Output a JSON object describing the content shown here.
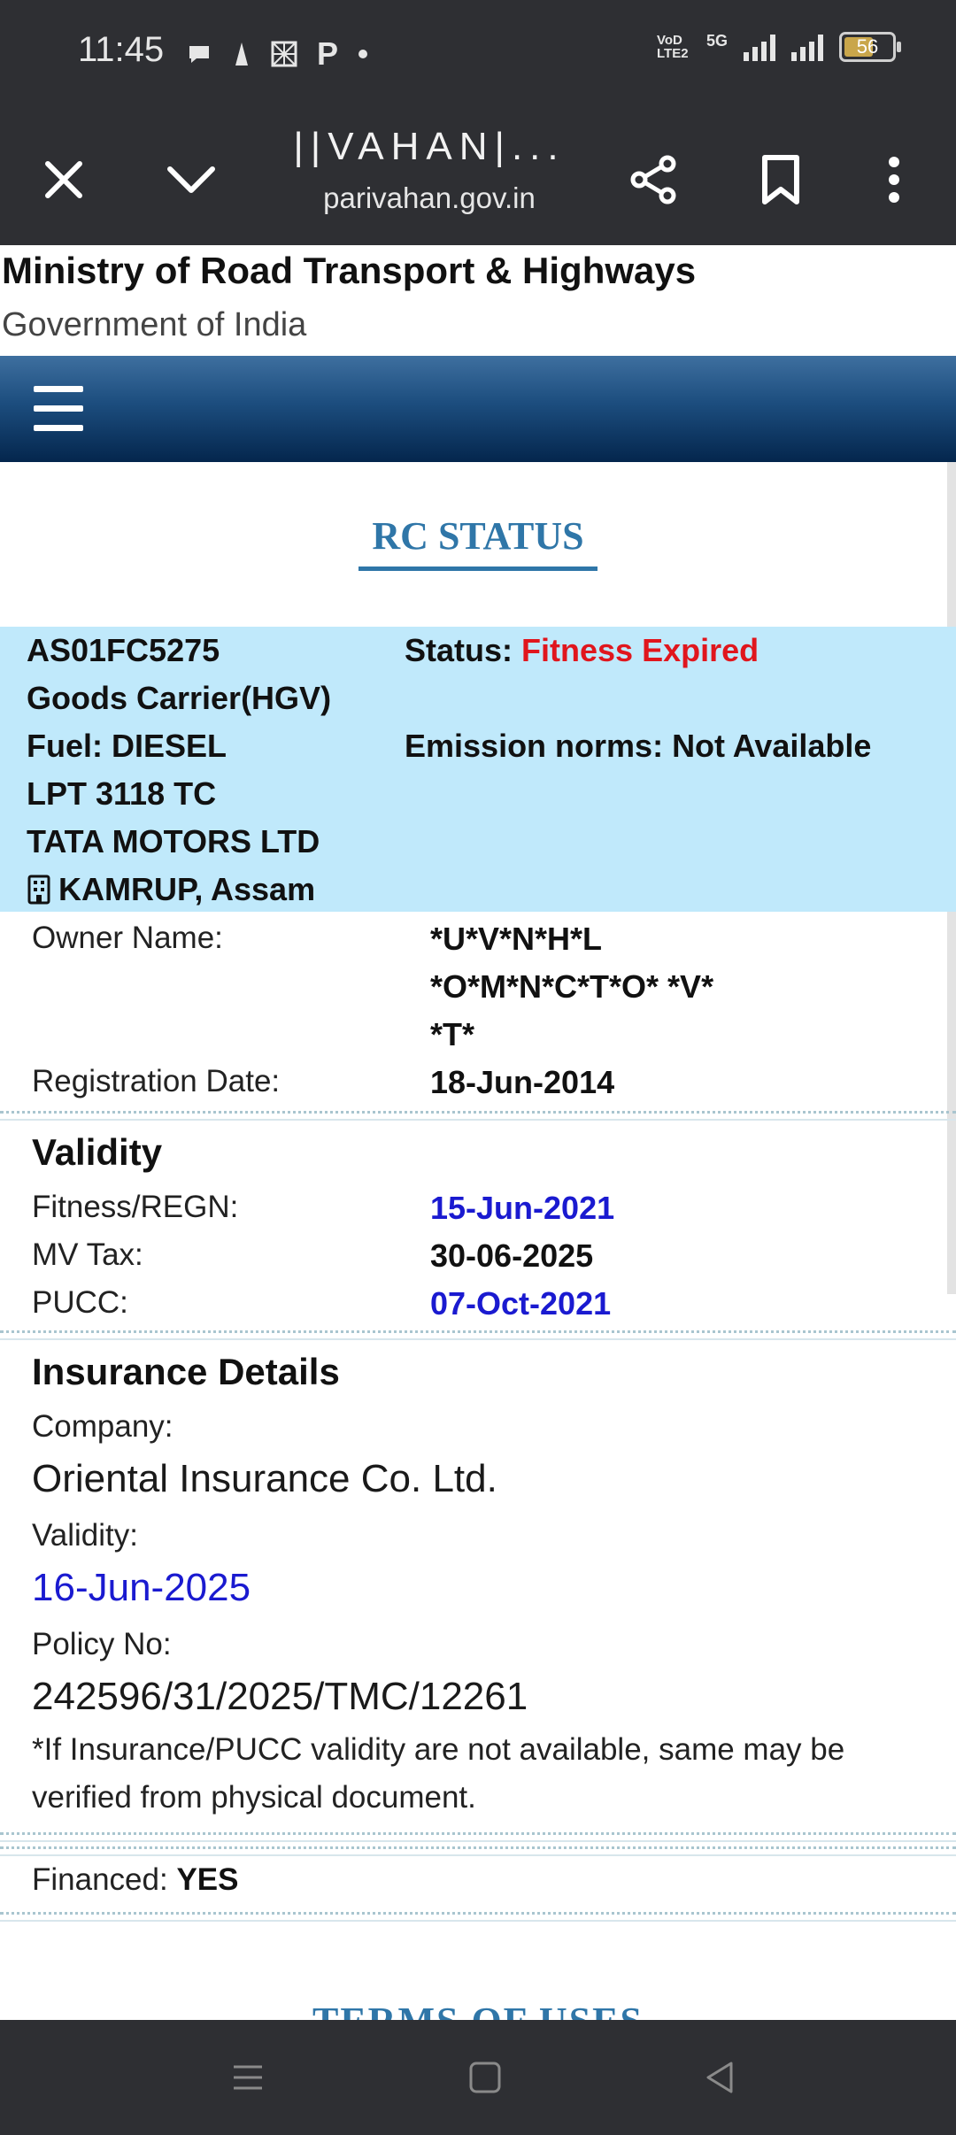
{
  "status_bar": {
    "time": "11:45",
    "notif_icons": [
      "chat-bubble-icon",
      "flame-icon",
      "checkered-icon",
      "p-letter-icon",
      "dot-icon"
    ],
    "p_label": "P",
    "network_label": "VoD LTE2",
    "network_gen": "5G",
    "battery": "56"
  },
  "browser": {
    "title": "||VAHAN|...",
    "url": "parivahan.gov.in"
  },
  "header": {
    "ministry": "Ministry of Road Transport & Highways",
    "government": "Government of India"
  },
  "page_title": "RC STATUS",
  "vehicle": {
    "reg_no": "AS01FC5275",
    "status_label": "Status:",
    "status_value": "Fitness Expired",
    "class": "Goods Carrier(HGV)",
    "fuel": "Fuel: DIESEL",
    "emission": "Emission norms: Not Available",
    "model": "LPT 3118 TC",
    "maker": "TATA MOTORS LTD",
    "rto": "KAMRUP, Assam"
  },
  "owner": {
    "name_label": "Owner Name:",
    "name_lines": [
      "*U*V*N*H*L",
      "*O*M*N*C*T*O* *V*",
      "*T*"
    ],
    "reg_date_label": "Registration Date:",
    "reg_date": "18-Jun-2014"
  },
  "validity": {
    "heading": "Validity",
    "fitness_label": "Fitness/REGN:",
    "fitness_value": "15-Jun-2021",
    "tax_label": "MV Tax:",
    "tax_value": "30-06-2025",
    "pucc_label": "PUCC:",
    "pucc_value": "07-Oct-2021"
  },
  "insurance": {
    "heading": "Insurance Details",
    "company_label": "Company:",
    "company_value": "Oriental Insurance Co. Ltd.",
    "validity_label": "Validity:",
    "validity_value": "16-Jun-2025",
    "policy_label": "Policy No:",
    "policy_value": "242596/31/2025/TMC/12261",
    "note": "*If Insurance/PUCC validity are not available, same may be verified from physical document."
  },
  "financed": {
    "label": "Financed:",
    "value": "YES"
  },
  "footer_heading": "TERMS OF USES",
  "colors": {
    "accent_blue": "#2f76a8",
    "status_red": "#e0161d",
    "date_blue": "#1a1ad0",
    "vehicle_bg": "#c0e9fb"
  }
}
